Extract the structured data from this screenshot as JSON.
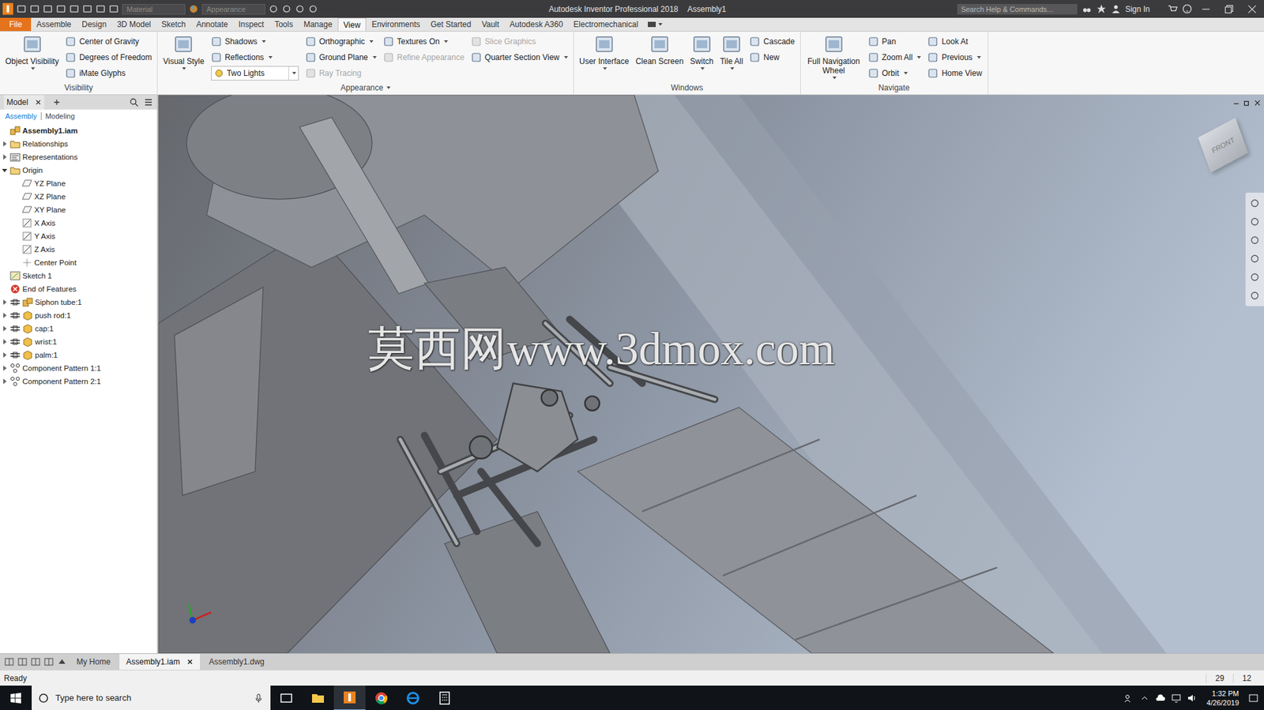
{
  "window": {
    "title": "Autodesk Inventor Professional 2018",
    "document": "Assembly1"
  },
  "quick_access": {
    "material": "Material",
    "appearance": "Appearance"
  },
  "search": {
    "placeholder": "Search Help & Commands..."
  },
  "account": {
    "label": "Sign In"
  },
  "ribbon_tabs": [
    {
      "label": "File",
      "selected": false,
      "kind": "file"
    },
    {
      "label": "Assemble",
      "selected": false,
      "kind": "tab"
    },
    {
      "label": "Design",
      "selected": false,
      "kind": "tab"
    },
    {
      "label": "3D Model",
      "selected": false,
      "kind": "tab"
    },
    {
      "label": "Sketch",
      "selected": false,
      "kind": "tab"
    },
    {
      "label": "Annotate",
      "selected": false,
      "kind": "tab"
    },
    {
      "label": "Inspect",
      "selected": false,
      "kind": "tab"
    },
    {
      "label": "Tools",
      "selected": false,
      "kind": "tab"
    },
    {
      "label": "Manage",
      "selected": false,
      "kind": "tab"
    },
    {
      "label": "View",
      "selected": true,
      "kind": "tab"
    },
    {
      "label": "Environments",
      "selected": false,
      "kind": "tab"
    },
    {
      "label": "Get Started",
      "selected": false,
      "kind": "tab"
    },
    {
      "label": "Vault",
      "selected": false,
      "kind": "tab"
    },
    {
      "label": "Autodesk A360",
      "selected": false,
      "kind": "tab"
    },
    {
      "label": "Electromechanical",
      "selected": false,
      "kind": "tab"
    }
  ],
  "ribbon_groups": [
    {
      "label": "Visibility",
      "menu": false,
      "columns": [
        {
          "kind": "large",
          "items": [
            {
              "label": "Object Visibility",
              "kind": "button",
              "dropdown": true,
              "disabled": false
            }
          ]
        },
        {
          "kind": "small",
          "items": [
            {
              "label": "Center of Gravity",
              "kind": "button",
              "dropdown": false,
              "disabled": false
            },
            {
              "label": "Degrees of Freedom",
              "kind": "button",
              "dropdown": false,
              "disabled": false
            },
            {
              "label": "iMate Glyphs",
              "kind": "button",
              "dropdown": false,
              "disabled": false
            }
          ]
        }
      ]
    },
    {
      "label": "Appearance",
      "menu": true,
      "columns": [
        {
          "kind": "large",
          "items": [
            {
              "label": "Visual Style",
              "kind": "button",
              "dropdown": true,
              "disabled": false
            }
          ]
        },
        {
          "kind": "small",
          "items": [
            {
              "label": "Shadows",
              "kind": "button",
              "dropdown": true,
              "disabled": false
            },
            {
              "label": "Reflections",
              "kind": "button",
              "dropdown": true,
              "disabled": false
            },
            {
              "label": "Two Lights",
              "kind": "select",
              "dropdown": true,
              "disabled": false
            }
          ]
        },
        {
          "kind": "small",
          "items": [
            {
              "label": "Orthographic",
              "kind": "button",
              "dropdown": true,
              "disabled": false
            },
            {
              "label": "Ground Plane",
              "kind": "button",
              "dropdown": true,
              "disabled": false
            },
            {
              "label": "Ray Tracing",
              "kind": "button",
              "dropdown": false,
              "disabled": true
            }
          ]
        },
        {
          "kind": "small",
          "items": [
            {
              "label": "Textures On",
              "kind": "button",
              "dropdown": true,
              "disabled": false
            },
            {
              "label": "Refine Appearance",
              "kind": "button",
              "dropdown": false,
              "disabled": true
            }
          ]
        },
        {
          "kind": "small",
          "items": [
            {
              "label": "Slice Graphics",
              "kind": "button",
              "dropdown": false,
              "disabled": true
            },
            {
              "label": "Quarter Section View",
              "kind": "button",
              "dropdown": true,
              "disabled": false
            }
          ]
        }
      ]
    },
    {
      "label": "Windows",
      "menu": false,
      "columns": [
        {
          "kind": "large",
          "items": [
            {
              "label": "User Interface",
              "kind": "button",
              "dropdown": true,
              "disabled": false
            }
          ]
        },
        {
          "kind": "large",
          "items": [
            {
              "label": "Clean Screen",
              "kind": "button",
              "dropdown": false,
              "disabled": false
            }
          ]
        },
        {
          "kind": "large",
          "items": [
            {
              "label": "Switch",
              "kind": "button",
              "dropdown": true,
              "disabled": false
            }
          ]
        },
        {
          "kind": "large",
          "items": [
            {
              "label": "Tile All",
              "kind": "button",
              "dropdown": true,
              "disabled": false
            }
          ]
        },
        {
          "kind": "small",
          "items": [
            {
              "label": "Cascade",
              "kind": "button",
              "dropdown": false,
              "disabled": false
            },
            {
              "label": "New",
              "kind": "button",
              "dropdown": false,
              "disabled": false
            }
          ]
        }
      ]
    },
    {
      "label": "Navigate",
      "menu": false,
      "columns": [
        {
          "kind": "large",
          "items": [
            {
              "label": "Full Navigation Wheel",
              "kind": "button",
              "dropdown": true,
              "disabled": false
            }
          ]
        },
        {
          "kind": "small",
          "items": [
            {
              "label": "Pan",
              "kind": "button",
              "dropdown": false,
              "disabled": false
            },
            {
              "label": "Zoom All",
              "kind": "button",
              "dropdown": true,
              "disabled": false
            },
            {
              "label": "Orbit",
              "kind": "button",
              "dropdown": true,
              "disabled": false
            }
          ]
        },
        {
          "kind": "small",
          "items": [
            {
              "label": "Look At",
              "kind": "button",
              "dropdown": false,
              "disabled": false
            },
            {
              "label": "Previous",
              "kind": "button",
              "dropdown": true,
              "disabled": false
            },
            {
              "label": "Home View",
              "kind": "button",
              "dropdown": false,
              "disabled": false
            }
          ]
        }
      ]
    }
  ],
  "browser": {
    "tab": "Model",
    "modes": [
      {
        "label": "Assembly",
        "selected": true
      },
      {
        "label": "Modeling",
        "selected": false
      }
    ],
    "tree": [
      {
        "label": "Assembly1.iam",
        "depth": 0,
        "kind": "assembly",
        "expandable": false,
        "expanded": false,
        "bold": true
      },
      {
        "label": "Relationships",
        "depth": 1,
        "kind": "folder",
        "expandable": true,
        "expanded": false,
        "bold": false
      },
      {
        "label": "Representations",
        "depth": 1,
        "kind": "representations",
        "expandable": true,
        "expanded": false,
        "bold": false
      },
      {
        "label": "Origin",
        "depth": 1,
        "kind": "folder",
        "expandable": true,
        "expanded": true,
        "bold": false
      },
      {
        "label": "YZ Plane",
        "depth": 2,
        "kind": "plane",
        "expandable": false,
        "expanded": false,
        "bold": false
      },
      {
        "label": "XZ Plane",
        "depth": 2,
        "kind": "plane",
        "expandable": false,
        "expanded": false,
        "bold": false
      },
      {
        "label": "XY Plane",
        "depth": 2,
        "kind": "plane",
        "expandable": false,
        "expanded": false,
        "bold": false
      },
      {
        "label": "X Axis",
        "depth": 2,
        "kind": "axis",
        "expandable": false,
        "expanded": false,
        "bold": false
      },
      {
        "label": "Y Axis",
        "depth": 2,
        "kind": "axis",
        "expandable": false,
        "expanded": false,
        "bold": false
      },
      {
        "label": "Z Axis",
        "depth": 2,
        "kind": "axis",
        "expandable": false,
        "expanded": false,
        "bold": false
      },
      {
        "label": "Center Point",
        "depth": 2,
        "kind": "point",
        "expandable": false,
        "expanded": false,
        "bold": false
      },
      {
        "label": "Sketch 1",
        "depth": 1,
        "kind": "sketch",
        "expandable": false,
        "expanded": false,
        "bold": false
      },
      {
        "label": "End of Features",
        "depth": 1,
        "kind": "end",
        "expandable": false,
        "expanded": false,
        "bold": false
      },
      {
        "label": "Siphon tube:1",
        "depth": 1,
        "kind": "subassembly",
        "expandable": true,
        "expanded": false,
        "bold": false
      },
      {
        "label": "push rod:1",
        "depth": 1,
        "kind": "part",
        "expandable": true,
        "expanded": false,
        "bold": false
      },
      {
        "label": "cap:1",
        "depth": 1,
        "kind": "part",
        "expandable": true,
        "expanded": false,
        "bold": false
      },
      {
        "label": "wrist:1",
        "depth": 1,
        "kind": "part",
        "expandable": true,
        "expanded": false,
        "bold": false
      },
      {
        "label": "palm:1",
        "depth": 1,
        "kind": "part",
        "expandable": true,
        "expanded": false,
        "bold": false
      },
      {
        "label": "Component Pattern 1:1",
        "depth": 1,
        "kind": "pattern",
        "expandable": true,
        "expanded": false,
        "bold": false
      },
      {
        "label": "Component Pattern 2:1",
        "depth": 1,
        "kind": "pattern",
        "expandable": true,
        "expanded": false,
        "bold": false
      }
    ]
  },
  "viewport": {
    "watermark": "莫西网www.3dmox.com",
    "view_cube": "FRONT"
  },
  "document_tabs": [
    {
      "label": "My Home",
      "selected": false,
      "closable": false
    },
    {
      "label": "Assembly1.iam",
      "selected": true,
      "closable": true
    },
    {
      "label": "Assembly1.dwg",
      "selected": false,
      "closable": false
    }
  ],
  "status_bar": {
    "text": "Ready",
    "counts": [
      "29",
      "12"
    ]
  },
  "taskbar": {
    "search_placeholder": "Type here to search",
    "time": "1:32 PM",
    "date": "4/26/2019"
  }
}
